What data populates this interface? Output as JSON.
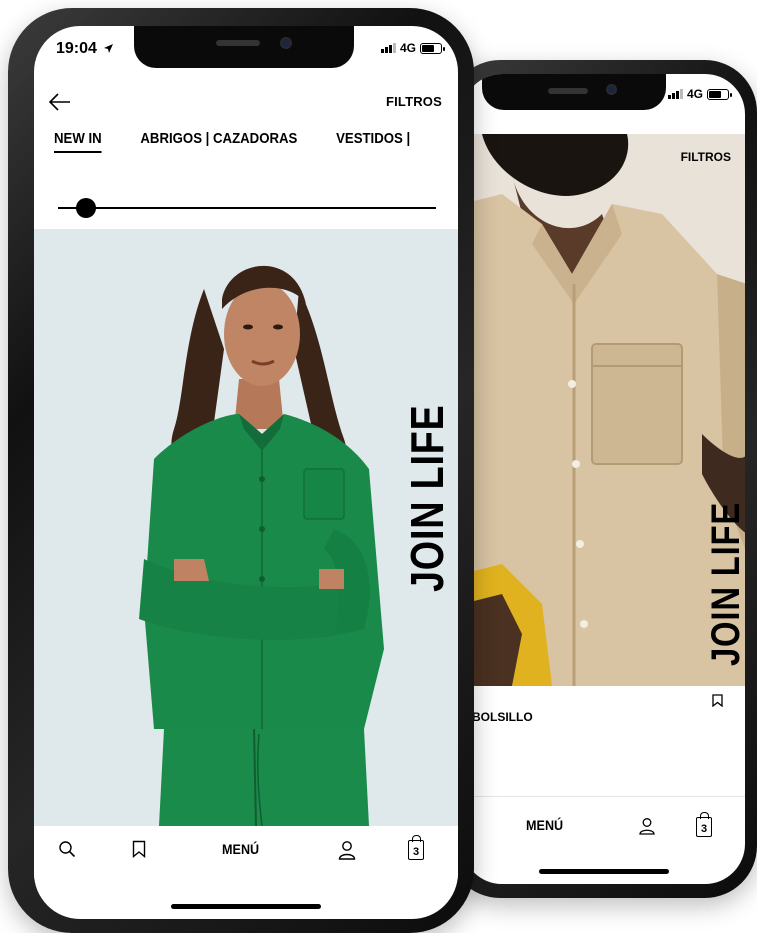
{
  "front_phone": {
    "status": {
      "time": "19:04",
      "network": "4G"
    },
    "header": {
      "filters_label": "FILTROS"
    },
    "tabs": [
      {
        "label": "NEW IN",
        "active": true
      },
      {
        "label": "ABRIGOS | CAZADORAS",
        "active": false
      },
      {
        "label": "VESTIDOS |",
        "active": false
      }
    ],
    "slider": {
      "level": 0.05
    },
    "hero": {
      "overlay_text": "JOIN LIFE",
      "background": "#dde7ea",
      "outfit_color": "#1b8b4c"
    },
    "bottom_nav": {
      "menu_label": "MENÚ",
      "cart_count": "3"
    }
  },
  "back_phone": {
    "status": {
      "network": "4G"
    },
    "header": {
      "filters_label": "FILTROS"
    },
    "hero": {
      "overlay_text": "JOIN LIFE",
      "outfit_color": "#d6bf9c"
    },
    "product": {
      "title": "BOLSILLO"
    },
    "bottom_nav": {
      "menu_label": "MENÚ",
      "cart_count": "3"
    }
  },
  "icons": [
    "back-arrow-icon",
    "search-icon",
    "bookmark-icon",
    "user-icon",
    "cart-icon",
    "signal-icon",
    "battery-icon",
    "location-arrow-icon"
  ]
}
